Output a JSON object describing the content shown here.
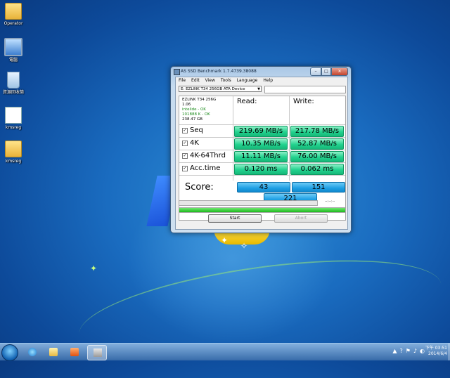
{
  "desktop": {
    "icons": [
      {
        "label": "Operator",
        "icon": "folder-icon"
      },
      {
        "label": "電腦",
        "icon": "computer-icon"
      },
      {
        "label": "資源回收筒",
        "icon": "recycle-bin-icon"
      },
      {
        "label": "kmsreg",
        "icon": "registry-file-icon"
      },
      {
        "label": "kmsreg",
        "icon": "folder-icon"
      }
    ]
  },
  "window": {
    "title": "AS SSD Benchmark 1.7.4739.38088",
    "menu": [
      "File",
      "Edit",
      "View",
      "Tools",
      "Language",
      "Help"
    ],
    "drive_select": "E: EZLINK T34 256GB ATA Device",
    "info": {
      "model": "EZLINK T34 256G",
      "firmware": "1.06",
      "driver_status": "intelide - OK",
      "alignment_status": "101888 K - OK",
      "capacity": "238.47 GB"
    },
    "columns": {
      "read": "Read:",
      "write": "Write:"
    },
    "rows": [
      {
        "label": "Seq",
        "read": "219.69 MB/s",
        "write": "217.78 MB/s",
        "checked": true
      },
      {
        "label": "4K",
        "read": "10.35 MB/s",
        "write": "52.87 MB/s",
        "checked": true
      },
      {
        "label": "4K-64Thrd",
        "read": "11.11 MB/s",
        "write": "76.00 MB/s",
        "checked": true
      },
      {
        "label": "Acc.time",
        "read": "0.120 ms",
        "write": "0.062 ms",
        "checked": true
      }
    ],
    "score": {
      "label": "Score:",
      "read": "43",
      "write": "151",
      "total": "221"
    },
    "timer": "--:--:--",
    "progress_fraction": 1.0,
    "buttons": {
      "start": "Start",
      "abort": "Abort"
    },
    "controls": {
      "minimize": "–",
      "maximize": "□",
      "close": "✕"
    }
  },
  "taskbar": {
    "tray_icons": [
      "network-icon",
      "help-icon",
      "flag-icon",
      "volume-icon",
      "battery-icon"
    ],
    "tray_glyphs": [
      "▲",
      "?",
      "⚑",
      "♪",
      "◐"
    ],
    "clock_time": "下午 03:51",
    "clock_date": "2014/6/4"
  }
}
